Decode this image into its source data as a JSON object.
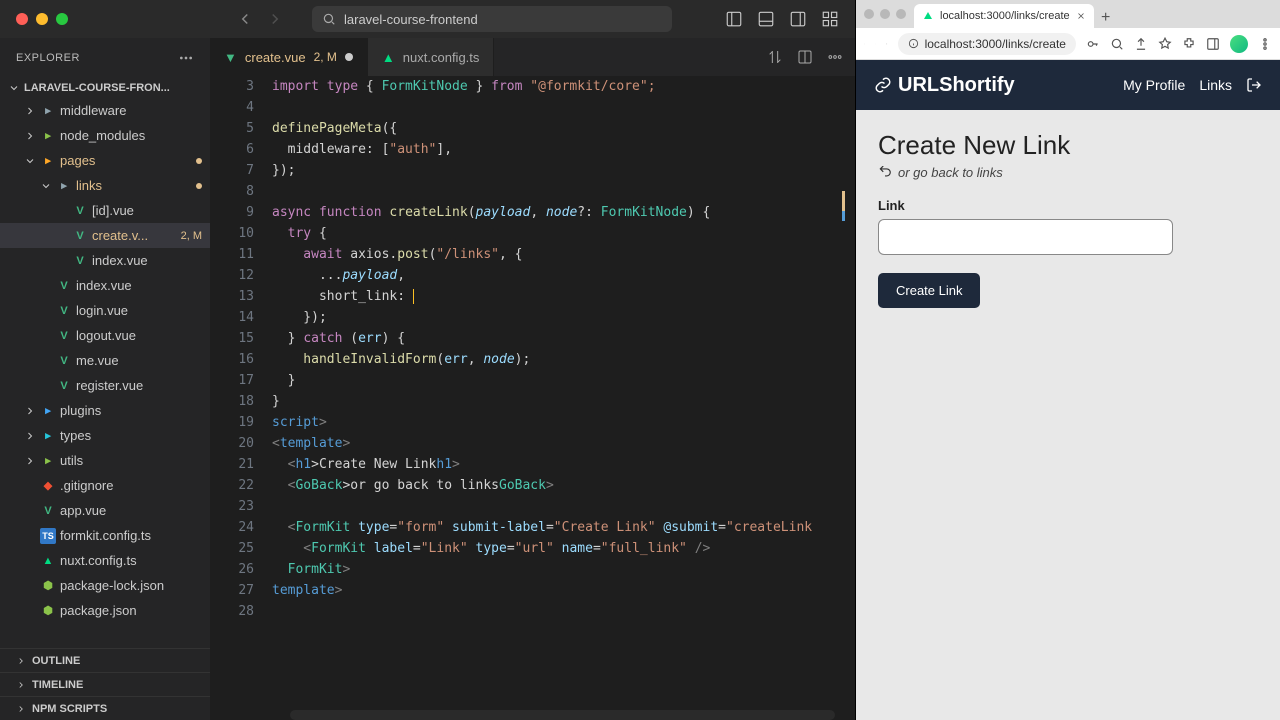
{
  "vscode": {
    "search": "laravel-course-frontend",
    "explorer_title": "EXPLORER",
    "project": "LARAVEL-COURSE-FRON...",
    "tabs": [
      {
        "name": "create.vue",
        "badge": "2, M",
        "active": true,
        "modified": true
      },
      {
        "name": "nuxt.config.ts",
        "badge": "",
        "active": false
      }
    ],
    "tree": [
      {
        "label": "middleware",
        "depth": 1,
        "kind": "folder",
        "chev": "right"
      },
      {
        "label": "node_modules",
        "depth": 1,
        "kind": "folder-green",
        "chev": "right"
      },
      {
        "label": "pages",
        "depth": 1,
        "kind": "folder-orange",
        "chev": "down",
        "mod": true
      },
      {
        "label": "links",
        "depth": 2,
        "kind": "folder",
        "chev": "down",
        "mod": true
      },
      {
        "label": "[id].vue",
        "depth": 3,
        "kind": "vue"
      },
      {
        "label": "create.v...",
        "depth": 3,
        "kind": "vue",
        "mod": true,
        "badge": "2, M",
        "selected": true
      },
      {
        "label": "index.vue",
        "depth": 3,
        "kind": "vue"
      },
      {
        "label": "index.vue",
        "depth": 2,
        "kind": "vue"
      },
      {
        "label": "login.vue",
        "depth": 2,
        "kind": "vue"
      },
      {
        "label": "logout.vue",
        "depth": 2,
        "kind": "vue"
      },
      {
        "label": "me.vue",
        "depth": 2,
        "kind": "vue"
      },
      {
        "label": "register.vue",
        "depth": 2,
        "kind": "vue"
      },
      {
        "label": "plugins",
        "depth": 1,
        "kind": "folder-blue",
        "chev": "right"
      },
      {
        "label": "types",
        "depth": 1,
        "kind": "folder-cyan",
        "chev": "right"
      },
      {
        "label": "utils",
        "depth": 1,
        "kind": "folder-green",
        "chev": "right"
      },
      {
        "label": ".gitignore",
        "depth": 1,
        "kind": "git"
      },
      {
        "label": "app.vue",
        "depth": 1,
        "kind": "vue"
      },
      {
        "label": "formkit.config.ts",
        "depth": 1,
        "kind": "ts"
      },
      {
        "label": "nuxt.config.ts",
        "depth": 1,
        "kind": "nuxt"
      },
      {
        "label": "package-lock.json",
        "depth": 1,
        "kind": "npm"
      },
      {
        "label": "package.json",
        "depth": 1,
        "kind": "npm"
      }
    ],
    "panels": [
      "OUTLINE",
      "TIMELINE",
      "NPM SCRIPTS"
    ],
    "code": {
      "lines": [
        3,
        4,
        5,
        6,
        7,
        8,
        9,
        10,
        11,
        12,
        13,
        14,
        15,
        16,
        17,
        18,
        19,
        20,
        21,
        22,
        23,
        24,
        25,
        26,
        27,
        28
      ],
      "l3": {
        "a": "import type",
        "b": " { ",
        "c": "FormKitNode",
        "d": " } ",
        "e": "from",
        "f": " \"@formkit/core\";",
        "pre": ""
      },
      "l5": "definePageMeta({",
      "l6a": "  middleware: [",
      "l6b": "\"auth\"",
      "l6c": "],",
      "l7": "});",
      "l9a": "async",
      "l9b": " function",
      "l9c": " createLink",
      "l9d": "(",
      "l9e": "payload",
      "l9f": ", ",
      "l9g": "node",
      "l9h": "?: ",
      "l9i": "FormKitNode",
      "l9j": ") {",
      "l10a": "  try",
      "l10b": " {",
      "l11a": "    await",
      "l11b": " axios.",
      "l11c": "post",
      "l11d": "(",
      "l11e": "\"/links\"",
      "l11f": ", {",
      "l12a": "      ...",
      "l12b": "payload",
      "l12c": ",",
      "l13a": "      short_link: ",
      "l14": "    });",
      "l15a": "  } ",
      "l15b": "catch",
      "l15c": " (",
      "l15d": "err",
      "l15e": ") {",
      "l16a": "    handleInvalidForm",
      "l16b": "(",
      "l16c": "err",
      "l16d": ", ",
      "l16e": "node",
      "l16f": ");",
      "l17": "  }",
      "l18": "}",
      "l19a": "</",
      "l19b": "script",
      "l19c": ">",
      "l20a": "<",
      "l20b": "template",
      "l20c": ">",
      "l21a": "  <",
      "l21b": "h1",
      "l21c": ">Create New Link</",
      "l21d": "h1",
      "l21e": ">",
      "l22a": "  <",
      "l22b": "GoBack",
      "l22c": ">or go back to links</",
      "l22d": "GoBack",
      "l22e": ">",
      "l24a": "  <",
      "l24b": "FormKit",
      "l24c": " type",
      "l24d": "=",
      "l24e": "\"form\"",
      "l24f": " submit-label",
      "l24g": "=",
      "l24h": "\"Create Link\"",
      "l24i": " @submit",
      "l24j": "=",
      "l24k": "\"createLink",
      "l25a": "    <",
      "l25b": "FormKit",
      "l25c": " label",
      "l25d": "=",
      "l25e": "\"Link\"",
      "l25f": " type",
      "l25g": "=",
      "l25h": "\"url\"",
      "l25i": " name",
      "l25j": "=",
      "l25k": "\"full_link\"",
      "l25l": " />",
      "l26a": "  </",
      "l26b": "FormKit",
      "l26c": ">",
      "l27a": "</",
      "l27b": "template",
      "l27c": ">"
    }
  },
  "browser": {
    "tab_title": "localhost:3000/links/create",
    "url": "localhost:3000/links/create",
    "app_name": "URLShortify",
    "nav": {
      "profile": "My Profile",
      "links": "Links"
    },
    "page": {
      "heading": "Create New Link",
      "goback": "or go back to links",
      "label": "Link",
      "submit": "Create Link"
    }
  }
}
